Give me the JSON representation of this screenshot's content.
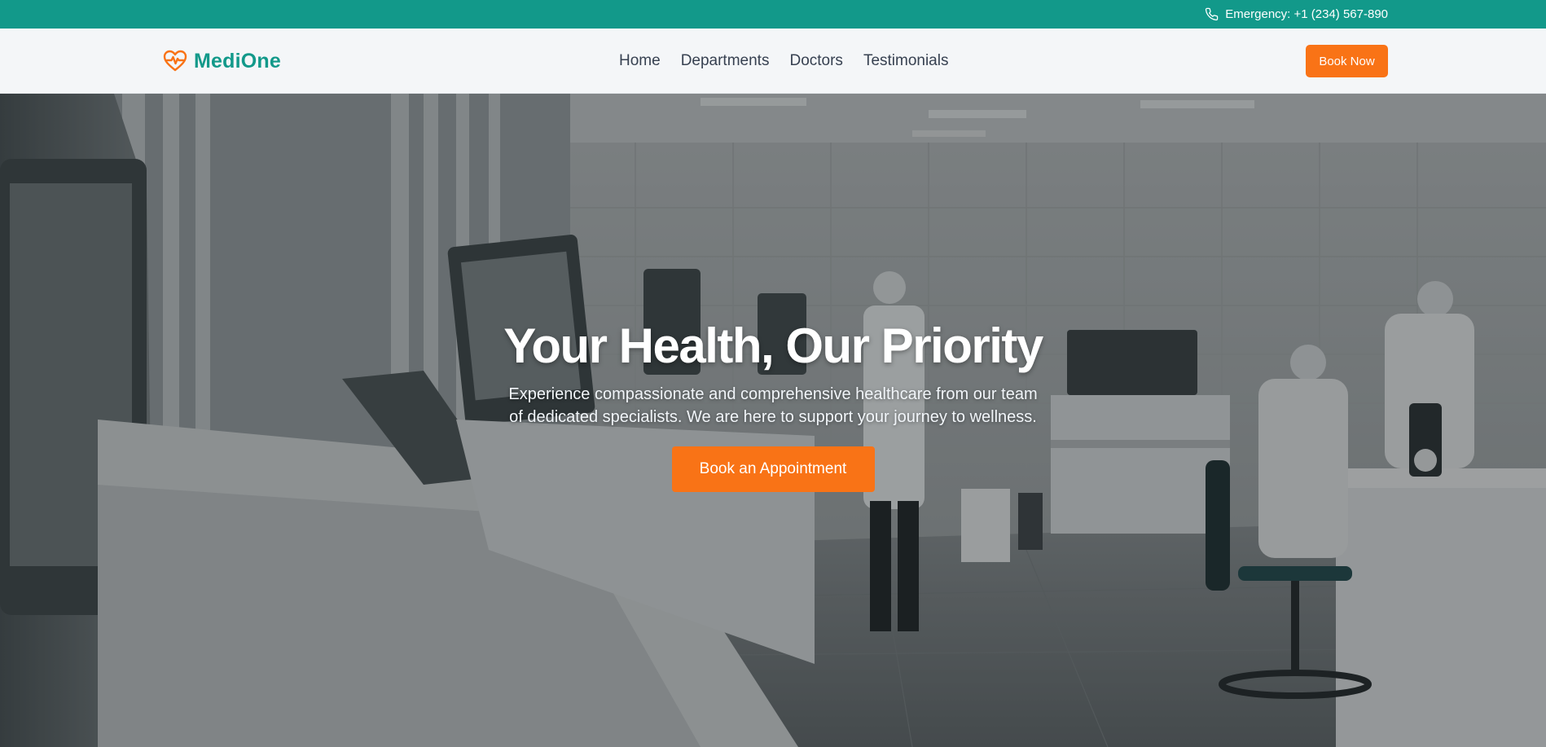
{
  "topbar": {
    "emergency_text": "Emergency: +1 (234) 567-890",
    "icon": "phone-icon",
    "background": "#12998a"
  },
  "header": {
    "logo_text": "MediOne",
    "logo_icon": "heart-pulse-icon",
    "nav": [
      "Home",
      "Departments",
      "Doctors",
      "Testimonials"
    ],
    "cta_label": "Book Now"
  },
  "hero": {
    "title": "Your Health, Our Priority",
    "subtitle": "Experience compassionate and comprehensive healthcare from our team of dedicated specialists. We are here to support your journey to wellness.",
    "cta_label": "Book an Appointment"
  },
  "colors": {
    "brand": "#12998a",
    "accent": "#f97316"
  }
}
